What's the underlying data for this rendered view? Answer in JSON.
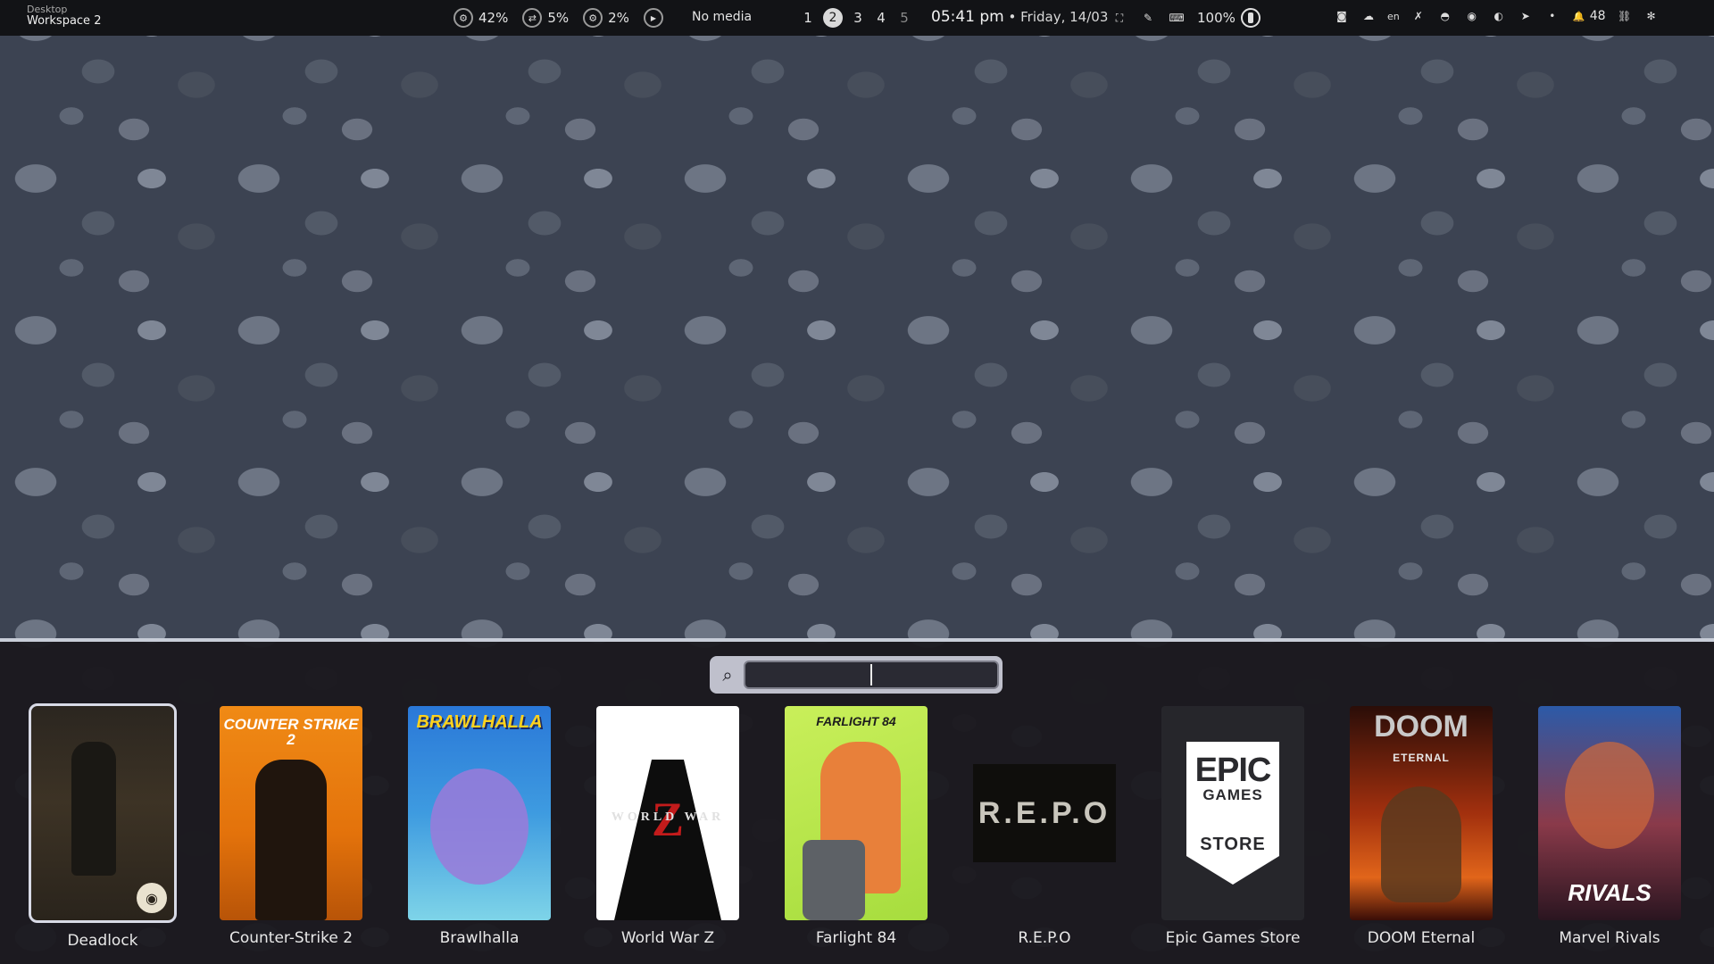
{
  "topbar": {
    "workspace_small": "Desktop",
    "workspace_big": "Workspace 2",
    "resources": [
      {
        "icon": "cpu-icon",
        "glyph": "⚙",
        "value": "42%"
      },
      {
        "icon": "swap-icon",
        "glyph": "⇄",
        "value": "5%"
      },
      {
        "icon": "gpu-icon",
        "glyph": "⚙",
        "value": "2%"
      }
    ],
    "media_play_glyph": "▶",
    "media_label": "No media",
    "workspaces": [
      {
        "label": "1",
        "state": "normal"
      },
      {
        "label": "2",
        "state": "active"
      },
      {
        "label": "3",
        "state": "normal"
      },
      {
        "label": "4",
        "state": "normal"
      },
      {
        "label": "5",
        "state": "dim"
      }
    ],
    "time": "05:41 pm",
    "date_sep": " • ",
    "date": "Friday, 14/03",
    "sys": {
      "screenshot_glyph": "⛶",
      "picker_glyph": "✎",
      "keyboard_glyph": "⌨",
      "battery_label": "100%"
    },
    "tray": [
      {
        "name": "tray-app1-icon",
        "glyph": "◙"
      },
      {
        "name": "tray-cloud-icon",
        "glyph": "☁"
      },
      {
        "name": "tray-lang-icon",
        "glyph": "en"
      },
      {
        "name": "tray-app2-icon",
        "glyph": "✗"
      },
      {
        "name": "tray-app3-icon",
        "glyph": "◓"
      },
      {
        "name": "tray-discord-icon",
        "glyph": "◉"
      },
      {
        "name": "tray-steam-icon",
        "glyph": "◐"
      },
      {
        "name": "tray-telegram-icon",
        "glyph": "➤"
      },
      {
        "name": "tray-dot-icon",
        "glyph": "•"
      }
    ],
    "notif_glyph": "🔔",
    "notif_count": "48",
    "network_glyph": "⛓",
    "bluetooth_glyph": "✻"
  },
  "launcher": {
    "search_glyph": "⌕",
    "search_value": "",
    "search_placeholder": "",
    "games": [
      {
        "label": "Deadlock",
        "cover": "deadlock",
        "selected": true
      },
      {
        "label": "Counter-Strike 2",
        "cover": "cs2",
        "cover_text": "COUNTER STRIKE 2"
      },
      {
        "label": "Brawlhalla",
        "cover": "brawl",
        "cover_text": "BRAWLHALLA"
      },
      {
        "label": "World War Z",
        "cover": "wwz",
        "cover_text": "WORLD WAR",
        "cover_z": "Z"
      },
      {
        "label": "Farlight 84",
        "cover": "farlight",
        "cover_text": "FARLIGHT 84"
      },
      {
        "label": "R.E.P.O",
        "cover": "repo",
        "cover_text": "R.E.P.O"
      },
      {
        "label": "Epic Games Store",
        "cover": "epic",
        "cover_text": "EPIC",
        "cover_mid": "GAMES",
        "cover_store": "STORE"
      },
      {
        "label": "DOOM Eternal",
        "cover": "doom",
        "cover_text": "DOOM",
        "cover_sub": "ETERNAL"
      },
      {
        "label": "Marvel Rivals",
        "cover": "rivals",
        "cover_text": "RIVALS"
      }
    ]
  }
}
